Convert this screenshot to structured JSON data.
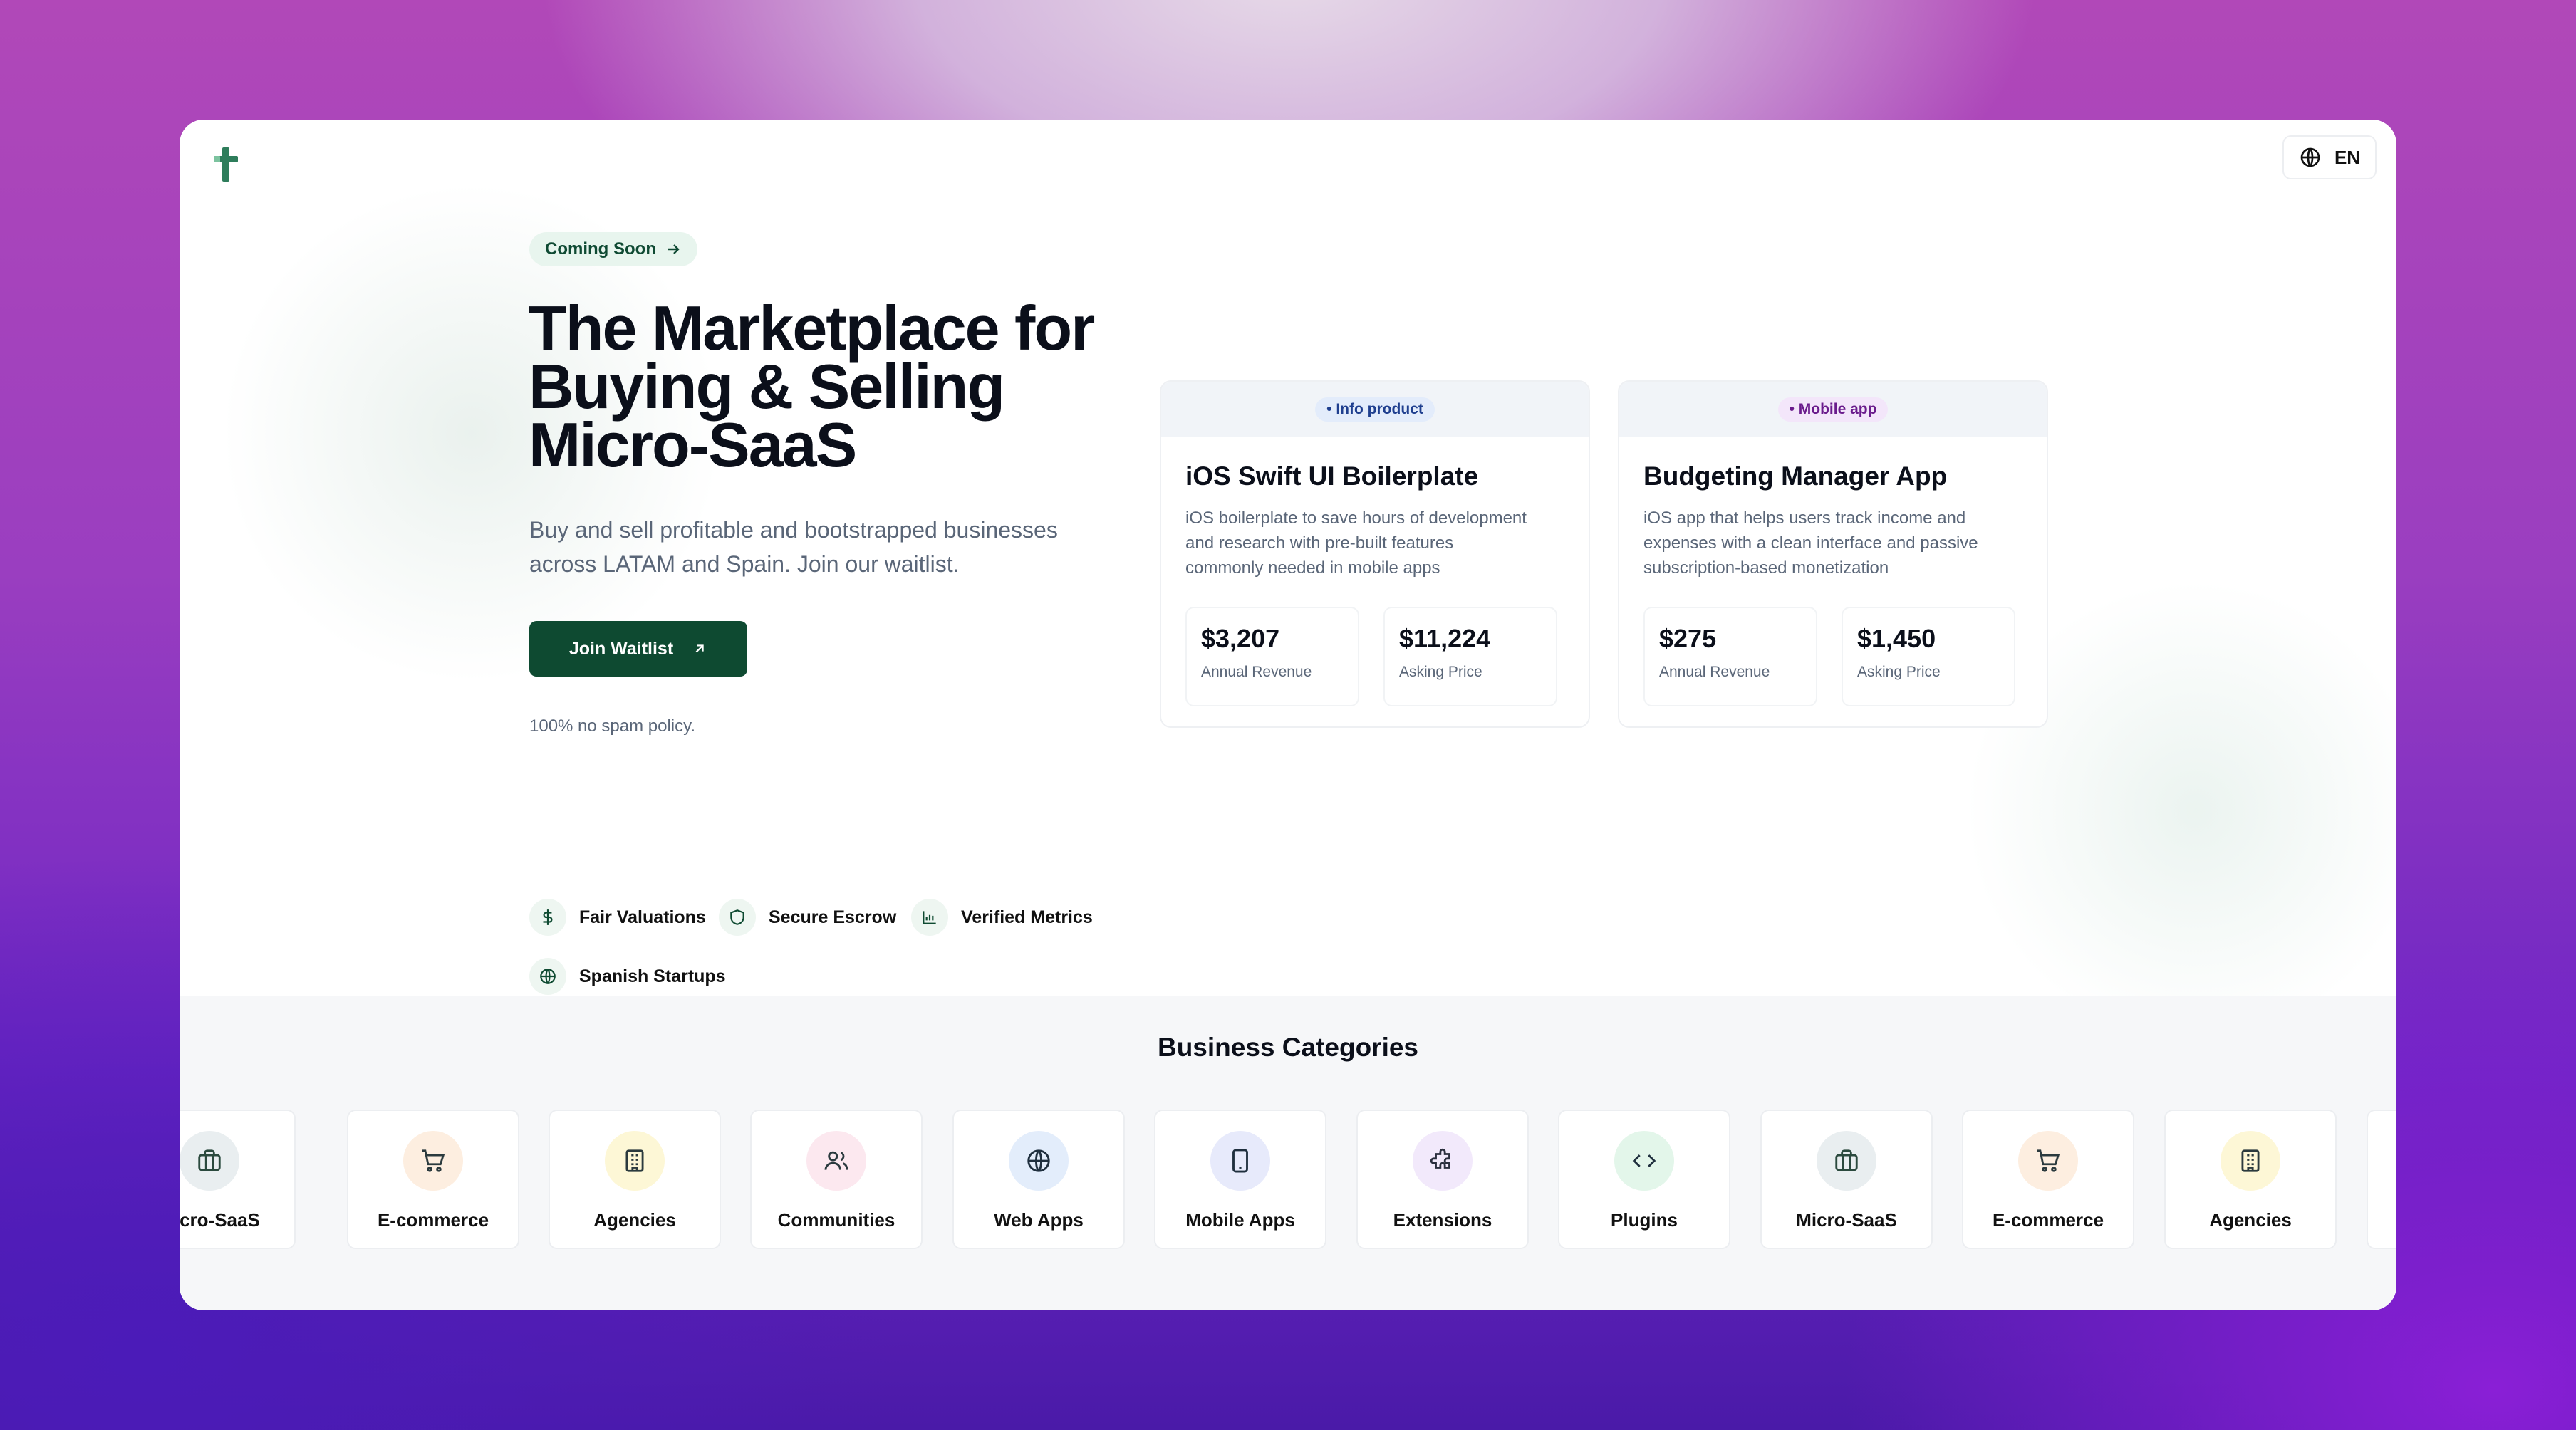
{
  "header": {
    "lang_label": "EN"
  },
  "hero": {
    "badge": "Coming Soon",
    "title_line1": "The Marketplace for",
    "title_line2": "Buying & Selling",
    "title_line3": "Micro-SaaS",
    "subtitle_line1": "Buy and sell profitable and bootstrapped businesses",
    "subtitle_line2": "across LATAM and Spain. Join our waitlist.",
    "cta_label": "Join Waitlist",
    "note": "100% no spam policy.",
    "features": [
      {
        "label": "Fair Valuations",
        "icon": "dollar-icon"
      },
      {
        "label": "Secure Escrow",
        "icon": "shield-icon"
      },
      {
        "label": "Verified Metrics",
        "icon": "bar-chart-icon"
      },
      {
        "label": "Spanish Startups",
        "icon": "globe-icon"
      }
    ]
  },
  "listings": [
    {
      "tag": "• Info product",
      "tag_bg": "#e3ecfb",
      "tag_color": "#1f3f8f",
      "title": "iOS Swift UI Boilerplate",
      "desc_line1": "iOS boilerplate to save hours of development",
      "desc_line2": "and research with pre-built features",
      "desc_line3": "commonly needed in mobile apps",
      "revenue": "$3,207",
      "revenue_label": "Annual Revenue",
      "price": "$11,224",
      "price_label": "Asking Price"
    },
    {
      "tag": "• Mobile app",
      "tag_bg": "#f3e6fa",
      "tag_color": "#6a1b8c",
      "title": "Budgeting Manager App",
      "desc_line1": "iOS app that helps users track income and",
      "desc_line2": "expenses with a clean interface and passive",
      "desc_line3": "subscription-based monetization",
      "revenue": "$275",
      "revenue_label": "Annual Revenue",
      "price": "$1,450",
      "price_label": "Asking Price"
    }
  ],
  "categories": {
    "title": "Business Categories",
    "items": [
      {
        "label": "Micro-SaaS",
        "icon": "briefcase-icon",
        "bg": "#e9eef0"
      },
      {
        "label": "E-commerce",
        "icon": "cart-icon",
        "bg": "#fdeee0"
      },
      {
        "label": "Agencies",
        "icon": "building-icon",
        "bg": "#fdf7d6"
      },
      {
        "label": "Communities",
        "icon": "users-icon",
        "bg": "#fce8ef"
      },
      {
        "label": "Web Apps",
        "icon": "globe-icon",
        "bg": "#e3edfb"
      },
      {
        "label": "Mobile Apps",
        "icon": "phone-icon",
        "bg": "#e7eafb"
      },
      {
        "label": "Extensions",
        "icon": "puzzle-icon",
        "bg": "#f2e9fb"
      },
      {
        "label": "Plugins",
        "icon": "code-icon",
        "bg": "#e3f6ea"
      },
      {
        "label": "Micro-SaaS",
        "icon": "briefcase-icon",
        "bg": "#e9eef0"
      },
      {
        "label": "E-commerce",
        "icon": "cart-icon",
        "bg": "#fdeee0"
      },
      {
        "label": "Agencies",
        "icon": "building-icon",
        "bg": "#fdf7d6"
      }
    ]
  },
  "colors": {
    "brand": "#0e4a31",
    "accent_bg": "#e8f5ee"
  }
}
